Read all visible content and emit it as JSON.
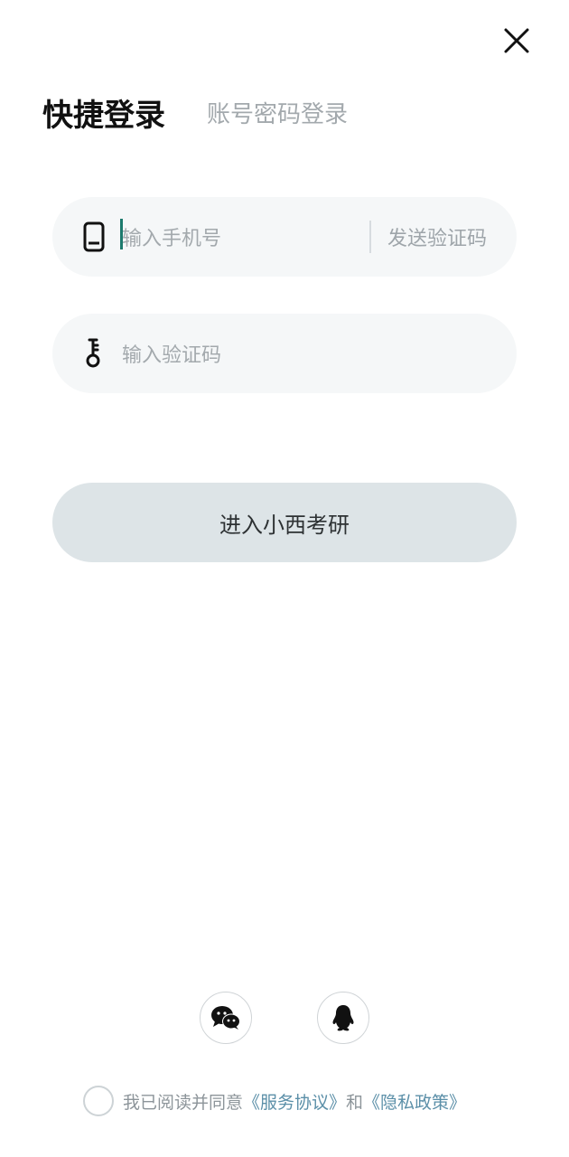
{
  "header": {
    "close_icon": "close-icon"
  },
  "tabs": {
    "active": "快捷登录",
    "inactive": "账号密码登录"
  },
  "phone_field": {
    "icon": "phone-icon",
    "placeholder": "输入手机号",
    "send_code_label": "发送验证码"
  },
  "code_field": {
    "icon": "key-icon",
    "placeholder": "输入验证码"
  },
  "submit": {
    "label": "进入小西考研"
  },
  "social": {
    "wechat_icon": "wechat-icon",
    "qq_icon": "qq-icon"
  },
  "agreement": {
    "prefix": "我已阅读并同意",
    "service_link": "《服务协议》",
    "conj": "和",
    "privacy_link": "《隐私政策》"
  },
  "colors": {
    "caret": "#1c7a6d",
    "link": "#5b8fa8",
    "button_bg": "#dde4e7",
    "field_bg": "#f5f7f8"
  }
}
